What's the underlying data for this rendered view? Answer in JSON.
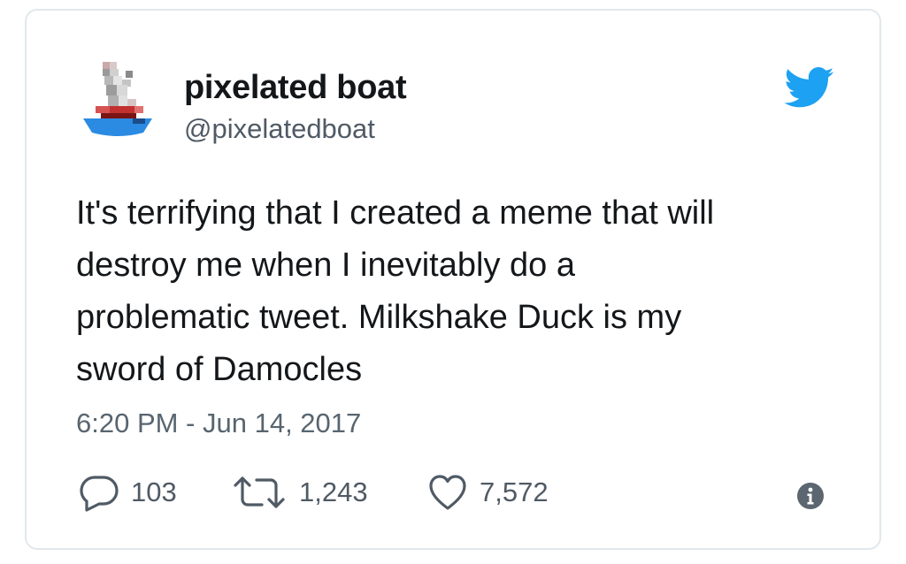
{
  "user": {
    "display_name": "pixelated boat",
    "handle": "@pixelatedboat",
    "avatar_icon": "pixelated-boat-avatar"
  },
  "brand": {
    "logo_icon": "twitter-bird-icon",
    "accent_color": "#1da1f2"
  },
  "tweet": {
    "text_lines": [
      "It's terrifying that I created a meme that will",
      "destroy me when I inevitably do a",
      "problematic tweet. Milkshake Duck is my",
      "sword of Damocles"
    ],
    "timestamp": "6:20 PM - Jun 14, 2017"
  },
  "actions": {
    "reply": {
      "icon": "reply-icon",
      "count": "103"
    },
    "retweet": {
      "icon": "retweet-icon",
      "count": "1,243"
    },
    "like": {
      "icon": "heart-icon",
      "count": "7,572"
    },
    "info": {
      "icon": "info-icon"
    }
  }
}
